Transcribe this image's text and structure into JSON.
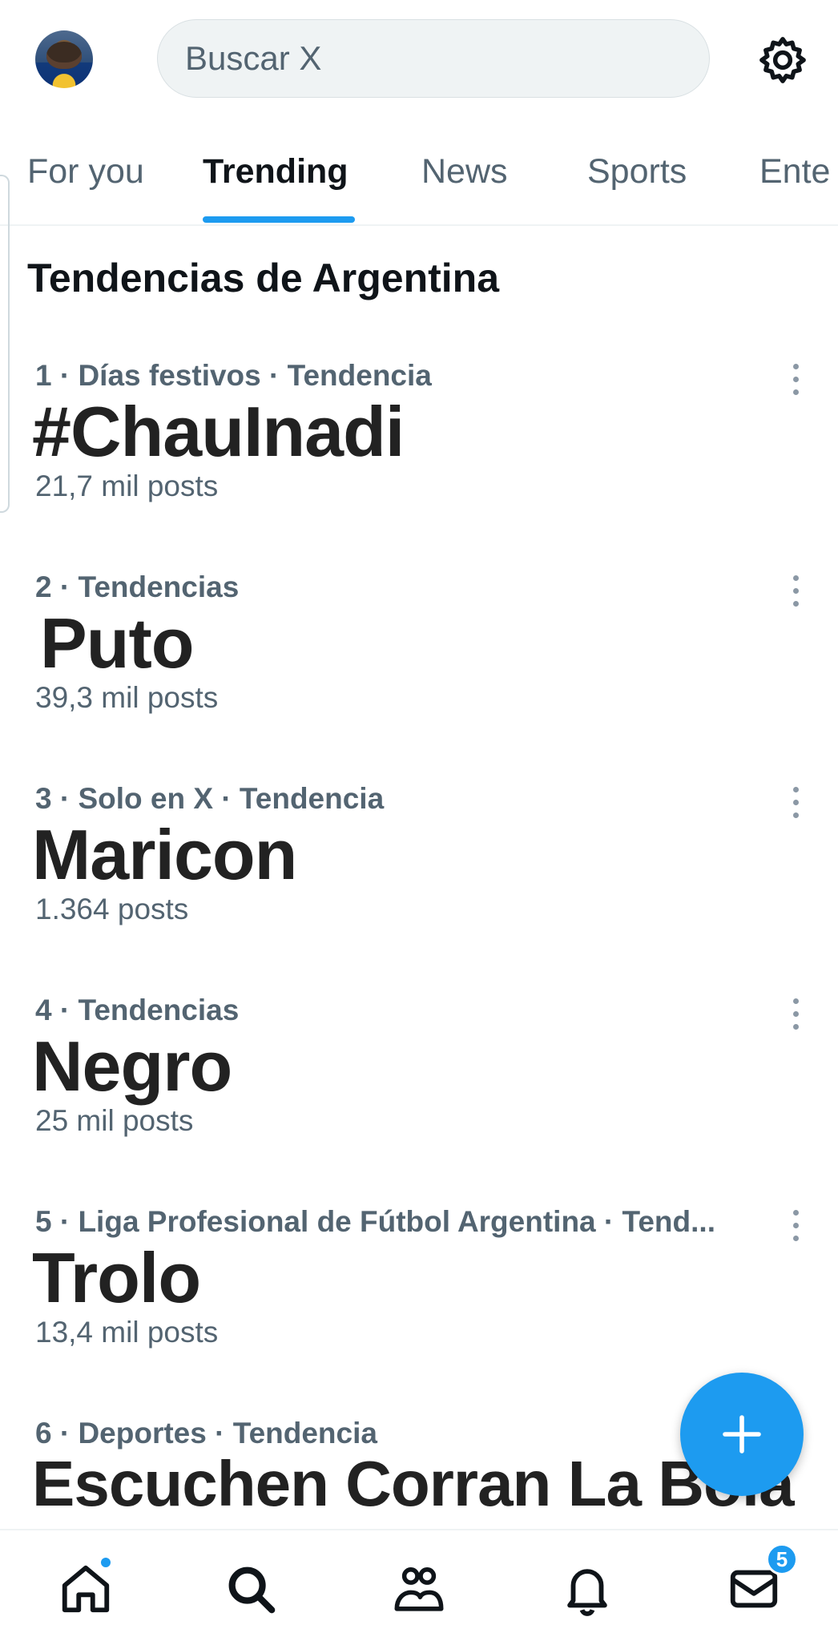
{
  "search": {
    "placeholder": "Buscar X"
  },
  "tabs": [
    {
      "label": "For you",
      "active": false
    },
    {
      "label": "Trending",
      "active": true
    },
    {
      "label": "News",
      "active": false
    },
    {
      "label": "Sports",
      "active": false
    },
    {
      "label": "Ente",
      "active": false
    }
  ],
  "section": {
    "title": "Tendencias de Argentina"
  },
  "trends": [
    {
      "meta": "1 · Días festivos · Tendencia",
      "title": "#ChauInadi",
      "count": "21,7 mil posts"
    },
    {
      "meta": "2 · Tendencias",
      "title": "Puto",
      "count": "39,3 mil posts"
    },
    {
      "meta": "3 · Solo en X · Tendencia",
      "title": "Maricon",
      "count": "1.364 posts"
    },
    {
      "meta": "4 · Tendencias",
      "title": "Negro",
      "count": "25 mil posts"
    },
    {
      "meta": "5 · Liga Profesional de Fútbol Argentina · Tend...",
      "title": "Trolo",
      "count": "13,4 mil posts"
    },
    {
      "meta": "6 · Deportes · Tendencia",
      "title": "Escuchen Corran La Bola",
      "count": ""
    }
  ],
  "bottom_nav": {
    "items": [
      {
        "name": "home-icon",
        "indicator": "dot"
      },
      {
        "name": "search-icon"
      },
      {
        "name": "communities-icon"
      },
      {
        "name": "notifications-icon"
      },
      {
        "name": "messages-icon",
        "badge": "5"
      }
    ]
  },
  "colors": {
    "accent": "#1d9bf0",
    "text": "#0f1419",
    "secondary": "#536471"
  }
}
